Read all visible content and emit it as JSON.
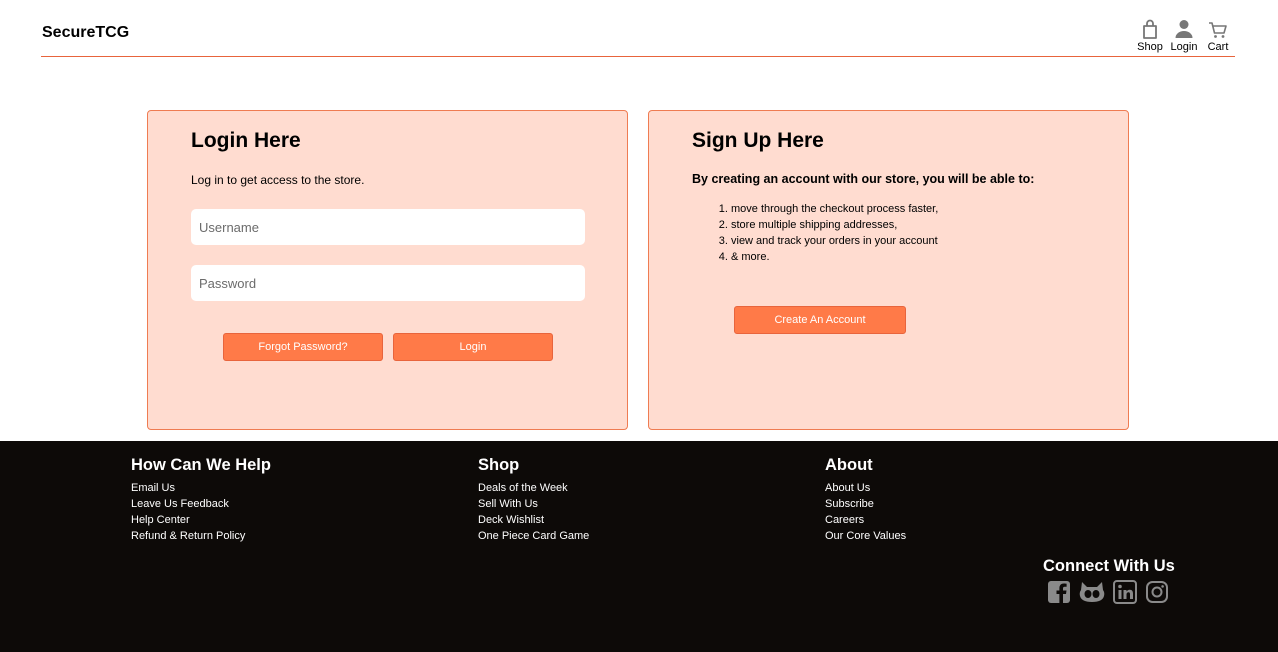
{
  "header": {
    "brand": "SecureTCG",
    "nav": [
      {
        "label": "Shop",
        "icon": "shopping-bag-icon"
      },
      {
        "label": "Login",
        "icon": "user-icon"
      },
      {
        "label": "Cart",
        "icon": "cart-icon"
      }
    ]
  },
  "login": {
    "title": "Login Here",
    "description": "Log in to get access to the store.",
    "username_placeholder": "Username",
    "password_placeholder": "Password",
    "forgot_label": "Forgot Password?",
    "login_label": "Login"
  },
  "signup": {
    "title": "Sign Up Here",
    "lead": "By creating an account with our store, you will be able to:",
    "benefits": [
      "move through the checkout process faster,",
      "store multiple shipping addresses,",
      "view and track your orders in your account",
      "& more."
    ],
    "create_label": "Create An Account"
  },
  "footer": {
    "help": {
      "title": "How Can We Help",
      "links": [
        "Email Us",
        "Leave Us Feedback",
        "Help Center",
        "Refund & Return Policy"
      ]
    },
    "shop": {
      "title": "Shop",
      "links": [
        "Deals of the Week",
        "Sell With Us",
        "Deck Wishlist",
        "One Piece Card Game"
      ]
    },
    "about": {
      "title": "About",
      "links": [
        "About Us",
        "Subscribe",
        "Careers",
        "Our Core Values"
      ]
    },
    "connect": {
      "title": "Connect With Us",
      "icons": [
        "facebook-icon",
        "github-icon",
        "linkedin-icon",
        "instagram-icon"
      ]
    }
  },
  "colors": {
    "accent": "#ff7a48",
    "accent_border": "#e8643c",
    "card_bg": "#ffdcd0",
    "footer_bg": "#0d0a08",
    "social_icon": "#8a8a8a"
  }
}
